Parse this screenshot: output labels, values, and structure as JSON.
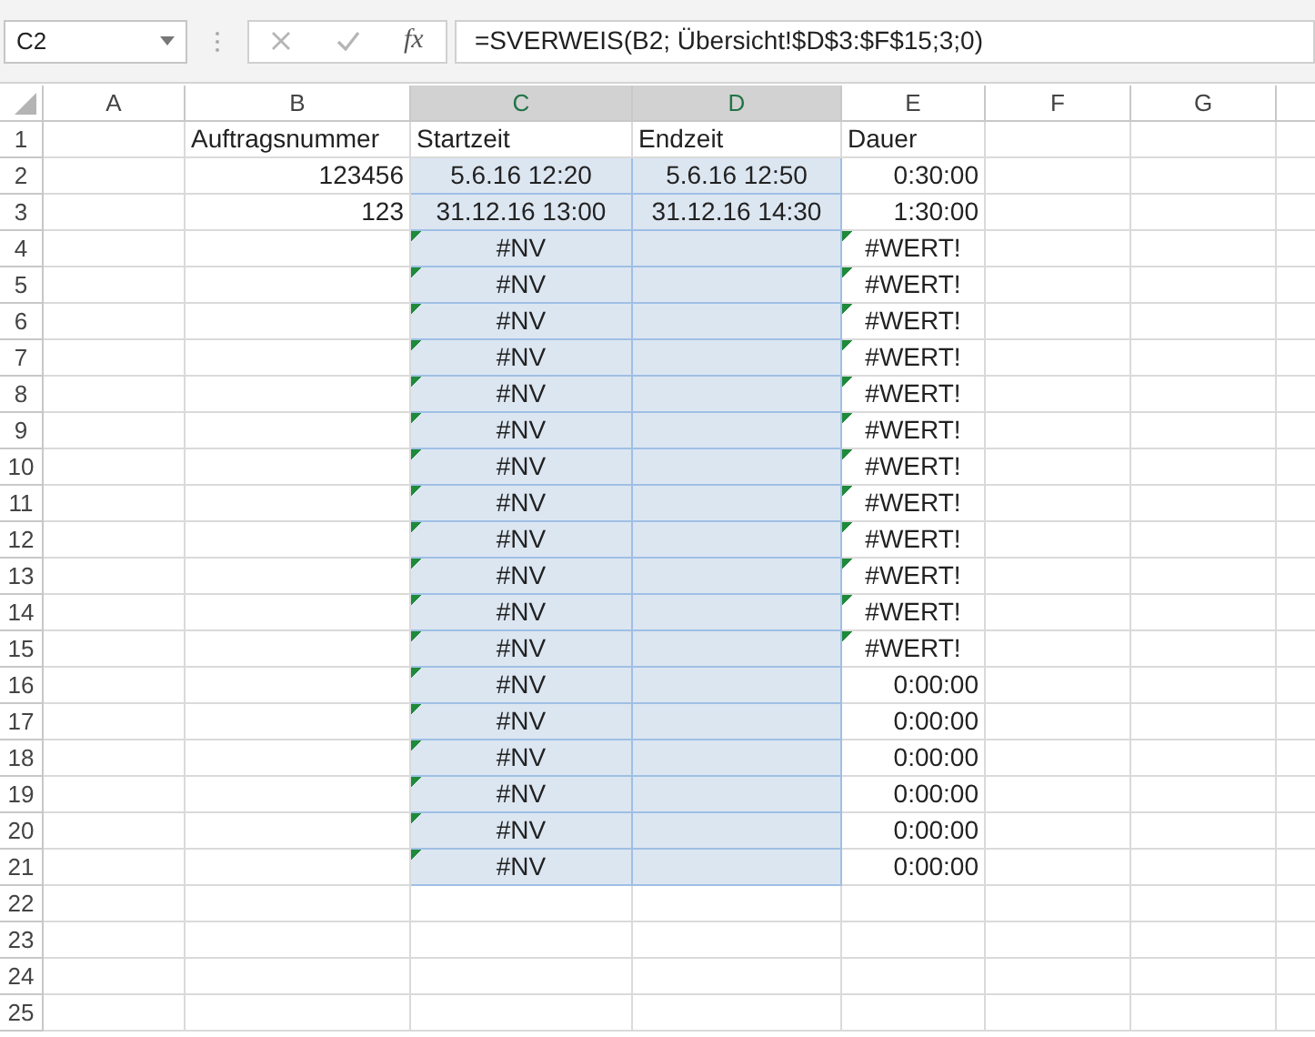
{
  "formula_bar": {
    "name_box": "C2",
    "function_button": "fx",
    "formula": "=SVERWEIS(B2; Übersicht!$D$3:$F$15;3;0)"
  },
  "columns": [
    {
      "label": "A",
      "selected": false
    },
    {
      "label": "B",
      "selected": false
    },
    {
      "label": "C",
      "selected": true
    },
    {
      "label": "D",
      "selected": true
    },
    {
      "label": "E",
      "selected": false
    },
    {
      "label": "F",
      "selected": false
    },
    {
      "label": "G",
      "selected": false
    }
  ],
  "rows": [
    {
      "number": "1",
      "B": {
        "text": "Auftragsnummer",
        "kind": "text"
      },
      "C": {
        "text": "Startzeit",
        "kind": "text"
      },
      "D": {
        "text": "Endzeit",
        "kind": "text"
      },
      "E": {
        "text": "Dauer",
        "kind": "text"
      }
    },
    {
      "number": "2",
      "B": {
        "text": "123456",
        "kind": "number"
      },
      "C": {
        "text": "5.6.16 12:20",
        "kind": "date",
        "selected": true
      },
      "D": {
        "text": "5.6.16 12:50",
        "kind": "date",
        "selected": true
      },
      "E": {
        "text": "0:30:00",
        "kind": "number"
      }
    },
    {
      "number": "3",
      "B": {
        "text": "123",
        "kind": "number"
      },
      "C": {
        "text": "31.12.16 13:00",
        "kind": "date",
        "selected": true
      },
      "D": {
        "text": "31.12.16 14:30",
        "kind": "date",
        "selected": true
      },
      "E": {
        "text": "1:30:00",
        "kind": "number"
      }
    },
    {
      "number": "4",
      "C": {
        "text": "#NV",
        "kind": "error",
        "flag": true,
        "selected": true
      },
      "D": {
        "selected": true
      },
      "E": {
        "text": "#WERT!",
        "kind": "error",
        "flag": true
      }
    },
    {
      "number": "5",
      "C": {
        "text": "#NV",
        "kind": "error",
        "flag": true,
        "selected": true
      },
      "D": {
        "selected": true
      },
      "E": {
        "text": "#WERT!",
        "kind": "error",
        "flag": true
      }
    },
    {
      "number": "6",
      "C": {
        "text": "#NV",
        "kind": "error",
        "flag": true,
        "selected": true
      },
      "D": {
        "selected": true
      },
      "E": {
        "text": "#WERT!",
        "kind": "error",
        "flag": true
      }
    },
    {
      "number": "7",
      "C": {
        "text": "#NV",
        "kind": "error",
        "flag": true,
        "selected": true
      },
      "D": {
        "selected": true
      },
      "E": {
        "text": "#WERT!",
        "kind": "error",
        "flag": true
      }
    },
    {
      "number": "8",
      "C": {
        "text": "#NV",
        "kind": "error",
        "flag": true,
        "selected": true
      },
      "D": {
        "selected": true
      },
      "E": {
        "text": "#WERT!",
        "kind": "error",
        "flag": true
      }
    },
    {
      "number": "9",
      "C": {
        "text": "#NV",
        "kind": "error",
        "flag": true,
        "selected": true
      },
      "D": {
        "selected": true
      },
      "E": {
        "text": "#WERT!",
        "kind": "error",
        "flag": true
      }
    },
    {
      "number": "10",
      "C": {
        "text": "#NV",
        "kind": "error",
        "flag": true,
        "selected": true
      },
      "D": {
        "selected": true
      },
      "E": {
        "text": "#WERT!",
        "kind": "error",
        "flag": true
      }
    },
    {
      "number": "11",
      "C": {
        "text": "#NV",
        "kind": "error",
        "flag": true,
        "selected": true
      },
      "D": {
        "selected": true
      },
      "E": {
        "text": "#WERT!",
        "kind": "error",
        "flag": true
      }
    },
    {
      "number": "12",
      "C": {
        "text": "#NV",
        "kind": "error",
        "flag": true,
        "selected": true
      },
      "D": {
        "selected": true
      },
      "E": {
        "text": "#WERT!",
        "kind": "error",
        "flag": true
      }
    },
    {
      "number": "13",
      "C": {
        "text": "#NV",
        "kind": "error",
        "flag": true,
        "selected": true
      },
      "D": {
        "selected": true
      },
      "E": {
        "text": "#WERT!",
        "kind": "error",
        "flag": true
      }
    },
    {
      "number": "14",
      "C": {
        "text": "#NV",
        "kind": "error",
        "flag": true,
        "selected": true
      },
      "D": {
        "selected": true
      },
      "E": {
        "text": "#WERT!",
        "kind": "error",
        "flag": true
      }
    },
    {
      "number": "15",
      "C": {
        "text": "#NV",
        "kind": "error",
        "flag": true,
        "selected": true
      },
      "D": {
        "selected": true
      },
      "E": {
        "text": "#WERT!",
        "kind": "error",
        "flag": true
      }
    },
    {
      "number": "16",
      "C": {
        "text": "#NV",
        "kind": "error",
        "flag": true,
        "selected": true
      },
      "D": {
        "selected": true
      },
      "E": {
        "text": "0:00:00",
        "kind": "number"
      }
    },
    {
      "number": "17",
      "C": {
        "text": "#NV",
        "kind": "error",
        "flag": true,
        "selected": true
      },
      "D": {
        "selected": true
      },
      "E": {
        "text": "0:00:00",
        "kind": "number"
      }
    },
    {
      "number": "18",
      "C": {
        "text": "#NV",
        "kind": "error",
        "flag": true,
        "selected": true
      },
      "D": {
        "selected": true
      },
      "E": {
        "text": "0:00:00",
        "kind": "number"
      }
    },
    {
      "number": "19",
      "C": {
        "text": "#NV",
        "kind": "error",
        "flag": true,
        "selected": true
      },
      "D": {
        "selected": true
      },
      "E": {
        "text": "0:00:00",
        "kind": "number"
      }
    },
    {
      "number": "20",
      "C": {
        "text": "#NV",
        "kind": "error",
        "flag": true,
        "selected": true
      },
      "D": {
        "selected": true
      },
      "E": {
        "text": "0:00:00",
        "kind": "number"
      }
    },
    {
      "number": "21",
      "C": {
        "text": "#NV",
        "kind": "error",
        "flag": true,
        "selected": true
      },
      "D": {
        "selected": true
      },
      "E": {
        "text": "0:00:00",
        "kind": "number"
      }
    },
    {
      "number": "22"
    },
    {
      "number": "23"
    },
    {
      "number": "24"
    },
    {
      "number": "25"
    }
  ]
}
